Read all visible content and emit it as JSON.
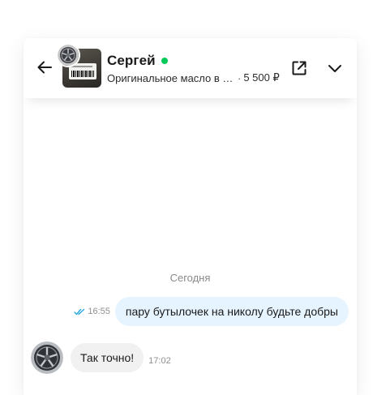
{
  "header": {
    "back_icon": "arrow-left-icon",
    "contact_name": "Сергей",
    "online": true,
    "online_color": "#03c95a",
    "item_title": "Оригинальное масло в бутылочках",
    "item_separator": "·",
    "item_price": "5 500 ₽",
    "open_icon": "external-link-icon",
    "collapse_icon": "chevron-down-icon"
  },
  "chat": {
    "date_separator": "Сегодня",
    "messages": [
      {
        "direction": "outgoing",
        "text": "пару бутылочек на николу будьте добры",
        "time": "16:55",
        "status_icon": "double-check-icon",
        "bubble_color": "#e6f4ff"
      },
      {
        "direction": "incoming",
        "text": "Так точно!",
        "time": "17:02",
        "bubble_color": "#f1f1f1"
      }
    ]
  },
  "colors": {
    "read_check": "#2aa9e0",
    "text_primary": "#1a1a1a",
    "text_muted": "#8f8f8f"
  }
}
